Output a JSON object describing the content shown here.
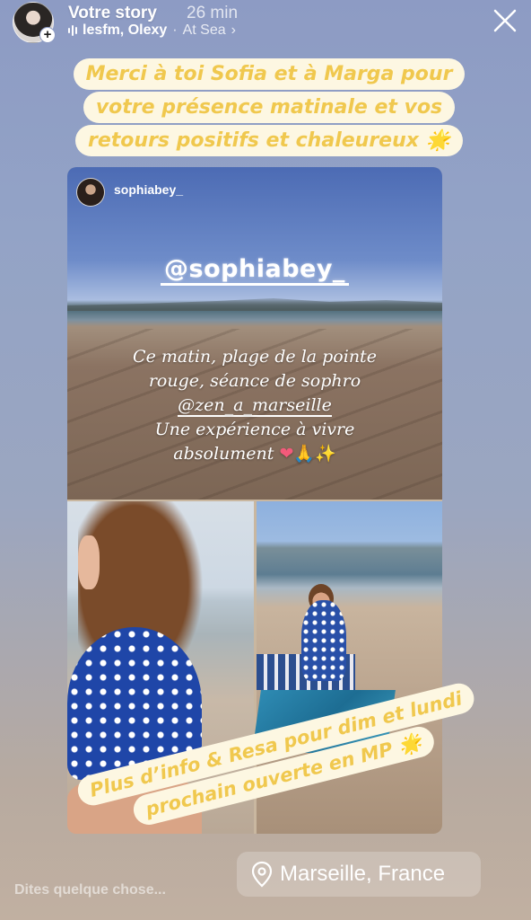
{
  "header": {
    "title": "Votre story",
    "time": "26 min",
    "music": {
      "artist": "lesfm, Olexy",
      "separator": "·",
      "track": "At Sea",
      "chevron": "›"
    },
    "avatar_plus": "+",
    "close_icon": "close-icon"
  },
  "captions": {
    "top": [
      "Merci à toi Sofia et à Marga pour",
      "votre présence matinale et vos",
      "retours positifs et chaleureux 🌟"
    ],
    "bottom": [
      "Plus d’info & Resa pour dim et lundi",
      "prochain ouverte en MP 🌟"
    ]
  },
  "post": {
    "username": "sophiabey_",
    "mention": "@sophiabey_",
    "text_line1": "Ce matin, plage de la pointe",
    "text_line2": "rouge, séance de sophro",
    "text_line3": "@zen_a_marseille",
    "text_line4": "Une expérience à vivre",
    "text_line5": "absolument",
    "text_emojis": [
      "❤",
      "🙏",
      "✨"
    ]
  },
  "location": {
    "label": "Marseille, France",
    "icon": "location-pin-icon"
  },
  "reply": {
    "placeholder": "Dites quelque chose..."
  },
  "colors": {
    "caption_text": "#f0c84e",
    "caption_bg": "#fdf7e2",
    "background_top": "#8d9bc4",
    "background_bottom": "#c1b0a1"
  }
}
